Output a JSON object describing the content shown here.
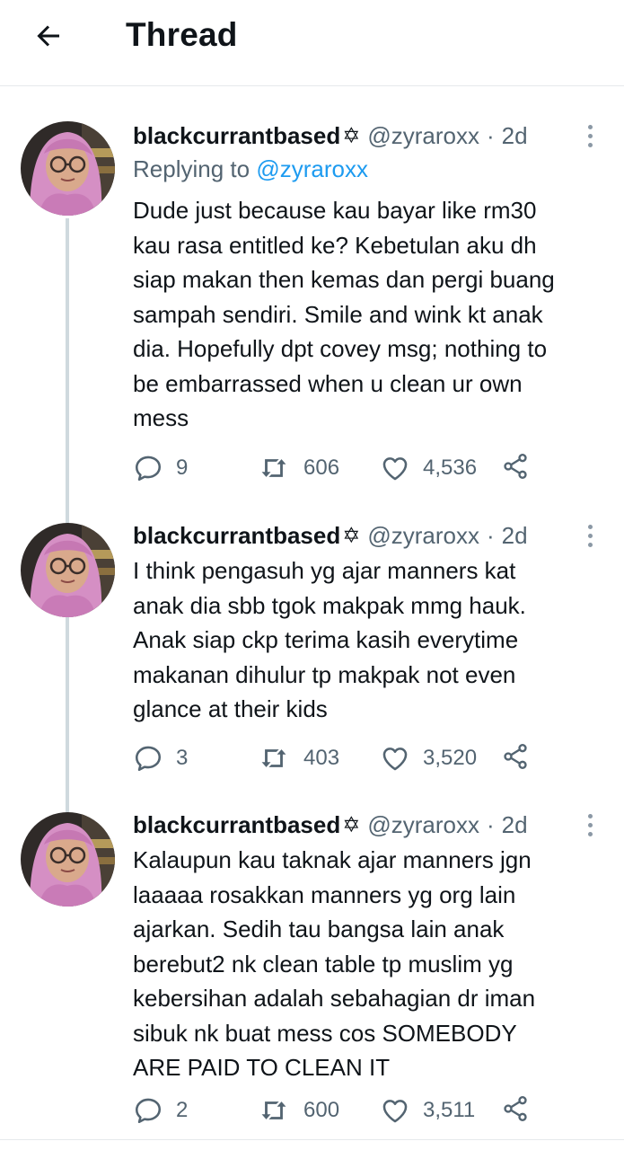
{
  "header": {
    "title": "Thread",
    "back_icon": "arrow-left-icon"
  },
  "colors": {
    "link": "#1d9bf0",
    "secondary_text": "#536471",
    "thread_line": "#cfd9de"
  },
  "tweets": [
    {
      "author_name": "blackcurrantbased",
      "author_badge": "✡",
      "handle": "@zyraroxx",
      "separator": "·",
      "time": "2d",
      "reply_prefix": "Replying to",
      "reply_handle": "@zyraroxx",
      "lines": [
        "Dude just because kau bayar like rm30",
        "kau rasa entitled ke? Kebetulan aku dh",
        "siap makan then kemas dan pergi buang",
        "sampah sendiri. Smile and wink kt anak",
        "dia. Hopefully dpt covey msg; nothing to",
        "be embarrassed when u clean ur own",
        "mess"
      ],
      "replies": "9",
      "retweets": "606",
      "likes": "4,536"
    },
    {
      "author_name": "blackcurrantbased",
      "author_badge": "✡",
      "handle": "@zyraroxx",
      "separator": "·",
      "time": "2d",
      "lines": [
        "I think pengasuh yg ajar manners kat",
        "anak dia sbb tgok makpak mmg hauk.",
        "Anak siap ckp terima kasih everytime",
        "makanan dihulur tp makpak not even",
        "glance at their kids"
      ],
      "replies": "3",
      "retweets": "403",
      "likes": "3,520"
    },
    {
      "author_name": "blackcurrantbased",
      "author_badge": "✡",
      "handle": "@zyraroxx",
      "separator": "·",
      "time": "2d",
      "lines": [
        "Kalaupun kau taknak ajar manners jgn",
        "laaaaa rosakkan manners yg org lain",
        "ajarkan. Sedih tau bangsa lain anak",
        "berebut2 nk clean table tp muslim yg",
        "kebersihan adalah sebahagian dr iman",
        "sibuk nk buat mess cos SOMEBODY",
        "ARE PAID TO CLEAN IT"
      ],
      "replies": "2",
      "retweets": "600",
      "likes": "3,511"
    }
  ]
}
